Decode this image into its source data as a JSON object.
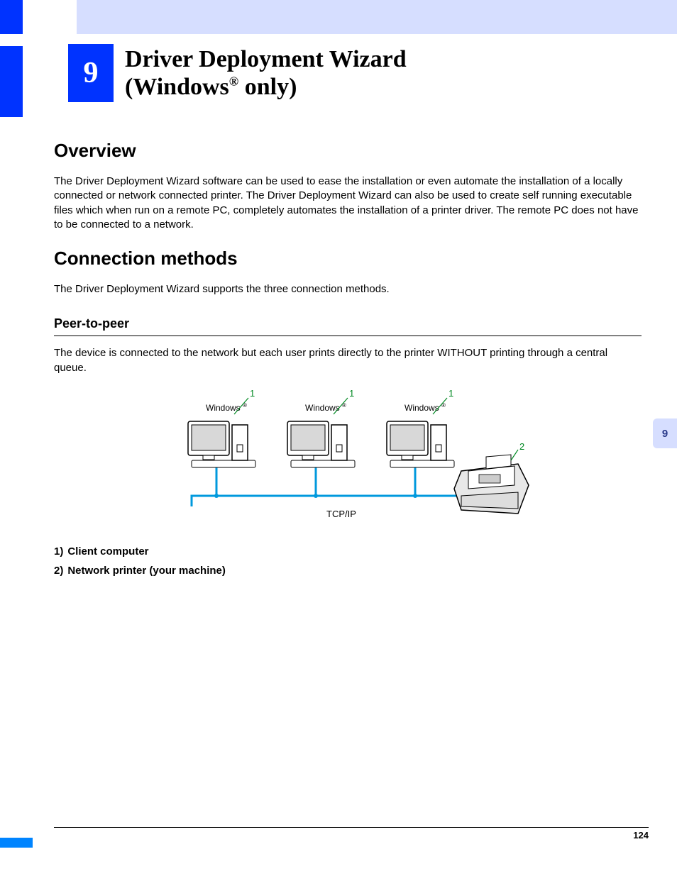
{
  "chapter": {
    "number": "9",
    "title_line1": "Driver Deployment Wizard",
    "title_line2a": "(Windows",
    "title_reg": "®",
    "title_line2b": " only)"
  },
  "sections": {
    "overview_heading": "Overview",
    "overview_body": "The Driver Deployment Wizard software can be used to ease the installation or even automate the installation of a locally connected or network connected printer. The Driver Deployment Wizard can also be used to create self running executable files which when run on a remote PC, completely automates the installation of a printer driver. The remote PC does not have to be connected to a network.",
    "connection_heading": "Connection methods",
    "connection_body": "The Driver Deployment Wizard supports the three connection methods.",
    "peer_heading": "Peer-to-peer",
    "peer_body": "The device is connected to the network but each user prints directly to the printer WITHOUT printing through a central queue."
  },
  "diagram": {
    "pc_label": "Windows",
    "reg": "®",
    "callout1": "1",
    "callout2": "2",
    "protocol": "TCP/IP"
  },
  "legend": {
    "item1_num": "1)",
    "item1_text": "Client computer",
    "item2_num": "2)",
    "item2_text": "Network printer (your machine)"
  },
  "side_tab": "9",
  "page_number": "124"
}
